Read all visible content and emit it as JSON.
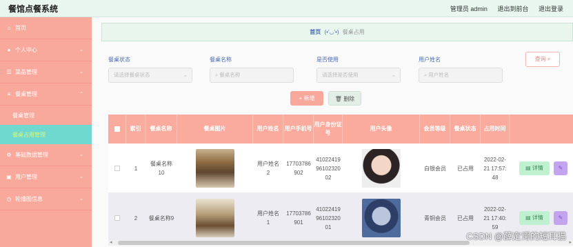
{
  "app": {
    "title": "餐馆点餐系统",
    "user_label": "管理员 admin",
    "front_link": "退出到前台",
    "logout_link": "退出登录"
  },
  "sidebar": {
    "items": [
      {
        "label": "首页",
        "icon": "home-icon"
      },
      {
        "label": "个人中心",
        "icon": "user-icon"
      },
      {
        "label": "菜品管理",
        "icon": "sliders-icon"
      },
      {
        "label": "餐桌管理",
        "icon": "list-icon"
      },
      {
        "label": "基础数据管理",
        "icon": "gear-icon"
      },
      {
        "label": "用户管理",
        "icon": "users-icon"
      },
      {
        "label": "轮播图信息",
        "icon": "clock-icon"
      }
    ],
    "subitems": [
      {
        "label": "餐桌管理"
      },
      {
        "label": "餐桌占用管理"
      }
    ]
  },
  "breadcrumb": {
    "home": "首页",
    "emoticon": "(•'◡'•)",
    "current": "餐桌占用"
  },
  "filters": {
    "status": {
      "label": "餐桌状态",
      "placeholder": "请选择餐桌状态"
    },
    "name": {
      "label": "餐桌名称",
      "placeholder": "餐桌名称"
    },
    "used": {
      "label": "是否使用",
      "placeholder": "请选择是否使用"
    },
    "username": {
      "label": "用户姓名",
      "placeholder": "用户姓名"
    },
    "search_label": "查询"
  },
  "actions": {
    "add": "+ 新增",
    "delete": "删除"
  },
  "table": {
    "headers": [
      "索引",
      "餐桌名称",
      "餐桌图片",
      "用户姓名",
      "用户手机号",
      "用户身份证号",
      "用户头像",
      "会员等级",
      "餐桌状态",
      "占用时间"
    ],
    "rows": [
      {
        "index": "1",
        "table_name": "餐桌名称10",
        "user_name": "用户姓名2",
        "phone": "17703786902",
        "id_card": "410224199610232002",
        "level": "白银会员",
        "status": "已占用",
        "time": "2022-02-21 17:57:48"
      },
      {
        "index": "2",
        "table_name": "餐桌名称9",
        "user_name": "用户姓名1",
        "phone": "17703786901",
        "id_card": "410224199610232001",
        "level": "青铜会员",
        "status": "已占用",
        "time": "2022-02-21 17:40:59"
      }
    ],
    "detail_label": "详情"
  },
  "watermark": "CSDN @薛定谔的短耳猫"
}
